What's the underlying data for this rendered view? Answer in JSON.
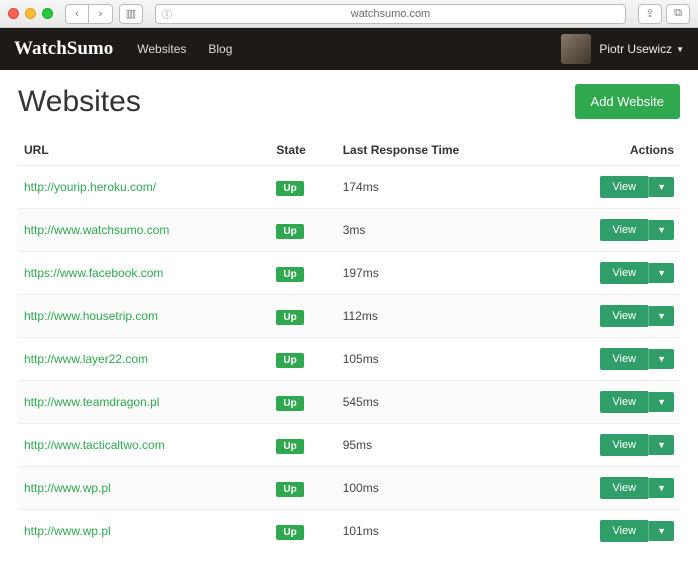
{
  "browser": {
    "address": "watchsumo.com"
  },
  "header": {
    "logo": "WatchSumo",
    "nav": {
      "websites": "Websites",
      "blog": "Blog"
    },
    "username": "Piotr Usewicz"
  },
  "page": {
    "title": "Websites",
    "add_button": "Add Website",
    "columns": {
      "url": "URL",
      "state": "State",
      "lrt": "Last Response Time",
      "actions": "Actions"
    },
    "view_label": "View",
    "state_up": "Up",
    "rows": [
      {
        "url": "http://yourip.heroku.com/",
        "state": "Up",
        "lrt": "174ms"
      },
      {
        "url": "http://www.watchsumo.com",
        "state": "Up",
        "lrt": "3ms"
      },
      {
        "url": "https://www.facebook.com",
        "state": "Up",
        "lrt": "197ms"
      },
      {
        "url": "http://www.housetrip.com",
        "state": "Up",
        "lrt": "112ms"
      },
      {
        "url": "http://www.layer22.com",
        "state": "Up",
        "lrt": "105ms"
      },
      {
        "url": "http://www.teamdragon.pl",
        "state": "Up",
        "lrt": "545ms"
      },
      {
        "url": "http://www.tacticaltwo.com",
        "state": "Up",
        "lrt": "95ms"
      },
      {
        "url": "http://www.wp.pl",
        "state": "Up",
        "lrt": "100ms"
      },
      {
        "url": "http://www.wp.pl",
        "state": "Up",
        "lrt": "101ms"
      }
    ]
  }
}
